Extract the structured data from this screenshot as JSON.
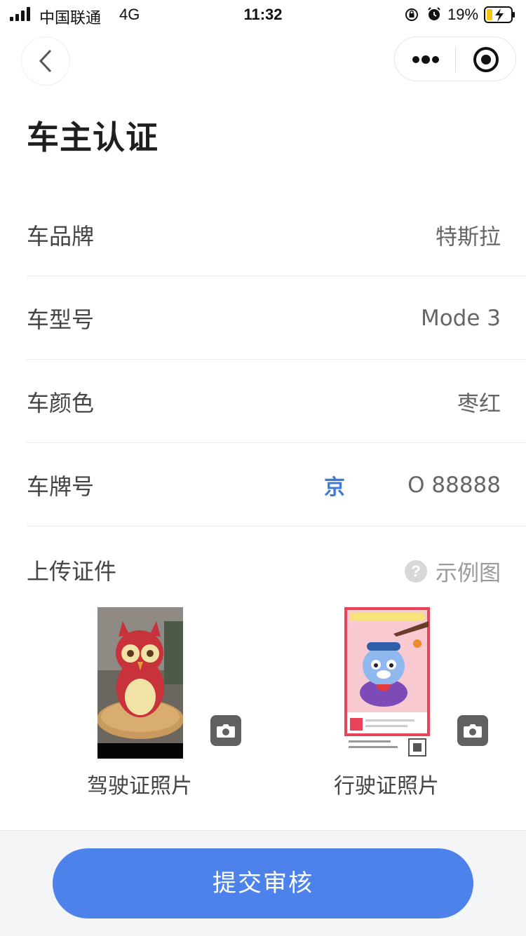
{
  "status_bar": {
    "carrier": "中国联通",
    "network": "4G",
    "time": "11:32",
    "battery": "19%"
  },
  "page": {
    "title": "车主认证"
  },
  "form": {
    "brand": {
      "label": "车品牌",
      "value": "特斯拉"
    },
    "model": {
      "label": "车型号",
      "value": "Mode 3"
    },
    "color": {
      "label": "车颜色",
      "value": "枣红"
    },
    "plate": {
      "label": "车牌号",
      "province": "京",
      "value": "O 88888"
    }
  },
  "upload": {
    "title": "上传证件",
    "example_link": "示例图",
    "driver_license_label": "驾驶证照片",
    "vehicle_license_label": "行驶证照片"
  },
  "submit_label": "提交审核",
  "colors": {
    "accent": "#4d82ea",
    "province": "#3f7ad8"
  }
}
